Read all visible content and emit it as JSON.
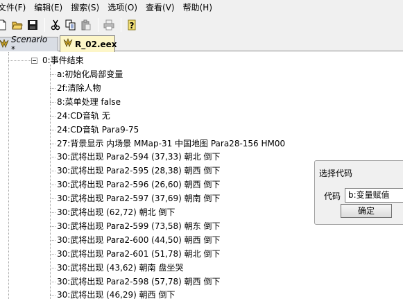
{
  "menu": [
    {
      "label": "文件(F)"
    },
    {
      "label": "编辑(E)"
    },
    {
      "label": "搜索(S)"
    },
    {
      "label": "选项(O)"
    },
    {
      "label": "查看(V)"
    },
    {
      "label": "帮助(H)"
    }
  ],
  "toolbar": {
    "buttons": [
      "new-file-icon",
      "open-folder-icon",
      "save-icon",
      "cut-icon",
      "copy-icon",
      "paste-icon",
      "print-icon",
      "help-icon"
    ]
  },
  "tabs": [
    {
      "label": "Scenario *",
      "icon": "scenario-icon"
    },
    {
      "label": "R_02.eex",
      "icon": "eex-file-icon"
    }
  ],
  "tree": {
    "root": {
      "label": "0:事件结束"
    },
    "items": [
      {
        "label": "a:初始化局部变量"
      },
      {
        "label": "2f:清除人物"
      },
      {
        "label": "8:菜单处理 false"
      },
      {
        "label": "24:CD音轨 无"
      },
      {
        "label": "24:CD音轨 Para9-75"
      },
      {
        "label": "27:背景显示 内场景 MMap-31 中国地图 Para28-156 HM00"
      },
      {
        "label": "30:武将出现 Para2-594 (37,33) 朝北 倒下"
      },
      {
        "label": "30:武将出现 Para2-595 (28,38) 朝西 倒下"
      },
      {
        "label": "30:武将出现 Para2-596 (26,60) 朝西 倒下"
      },
      {
        "label": "30:武将出现 Para2-597 (37,69) 朝南 倒下"
      },
      {
        "label": "30:武将出现  (62,72) 朝北 倒下"
      },
      {
        "label": "30:武将出现 Para2-599 (73,58) 朝东 倒下"
      },
      {
        "label": "30:武将出现 Para2-600 (44,50) 朝西 倒下"
      },
      {
        "label": "30:武将出现 Para2-601 (51,78) 朝北 倒下"
      },
      {
        "label": "30:武将出现  (43,62) 朝南 盘坐哭"
      },
      {
        "label": "30:武将出现 Para2-598 (57,78) 朝西 倒下"
      },
      {
        "label": "30:武将出现  (46,29) 朝西 倒下"
      }
    ]
  },
  "dialog": {
    "title": "选择代码",
    "code_label": "代码",
    "selected": "b:变量赋值",
    "ok_label": "确定"
  }
}
